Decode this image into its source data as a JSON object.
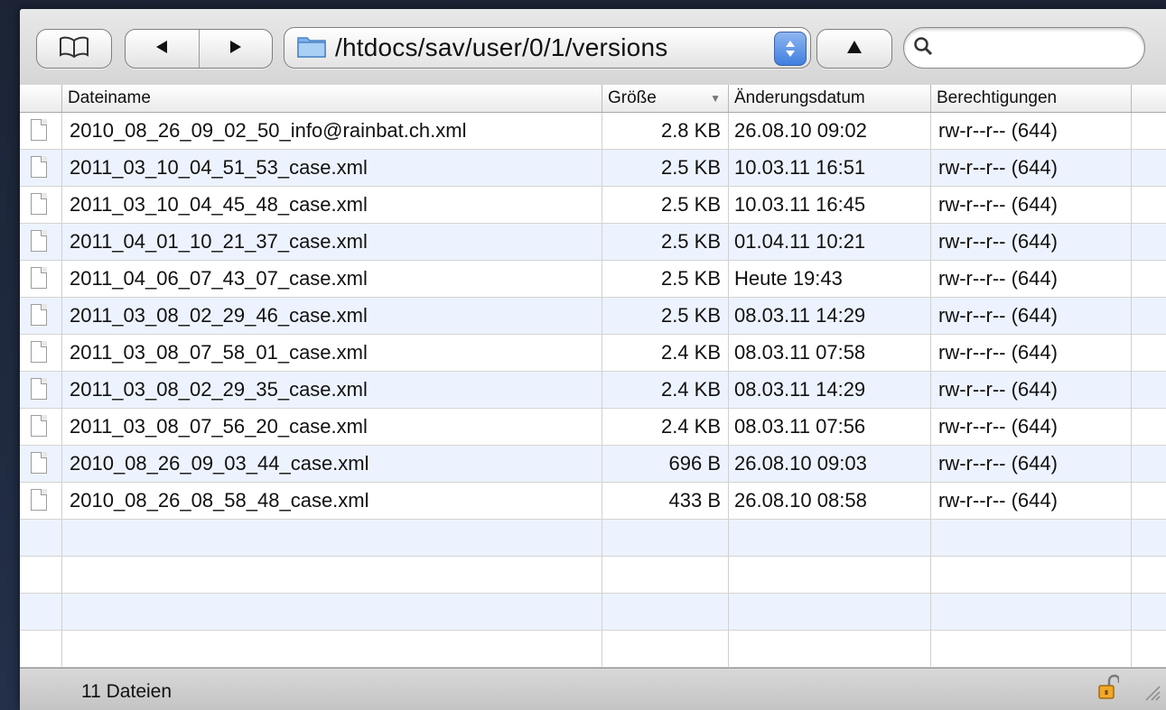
{
  "toolbar": {
    "path": "/htdocs/sav/user/0/1/versions",
    "search_placeholder": ""
  },
  "columns": {
    "name": "Dateiname",
    "size": "Größe",
    "date": "Änderungsdatum",
    "permissions": "Berechtigungen"
  },
  "sort": {
    "column": "size",
    "direction": "descending"
  },
  "files": [
    {
      "name": "2010_08_26_09_02_50_info@rainbat.ch.xml",
      "size": "2.8 KB",
      "date": "26.08.10 09:02",
      "perm": "rw-r--r-- (644)"
    },
    {
      "name": "2011_03_10_04_51_53_case.xml",
      "size": "2.5 KB",
      "date": "10.03.11 16:51",
      "perm": "rw-r--r-- (644)"
    },
    {
      "name": "2011_03_10_04_45_48_case.xml",
      "size": "2.5 KB",
      "date": "10.03.11 16:45",
      "perm": "rw-r--r-- (644)"
    },
    {
      "name": "2011_04_01_10_21_37_case.xml",
      "size": "2.5 KB",
      "date": "01.04.11 10:21",
      "perm": "rw-r--r-- (644)"
    },
    {
      "name": "2011_04_06_07_43_07_case.xml",
      "size": "2.5 KB",
      "date": "Heute 19:43",
      "perm": "rw-r--r-- (644)"
    },
    {
      "name": "2011_03_08_02_29_46_case.xml",
      "size": "2.5 KB",
      "date": "08.03.11 14:29",
      "perm": "rw-r--r-- (644)"
    },
    {
      "name": "2011_03_08_07_58_01_case.xml",
      "size": "2.4 KB",
      "date": "08.03.11 07:58",
      "perm": "rw-r--r-- (644)"
    },
    {
      "name": "2011_03_08_02_29_35_case.xml",
      "size": "2.4 KB",
      "date": "08.03.11 14:29",
      "perm": "rw-r--r-- (644)"
    },
    {
      "name": "2011_03_08_07_56_20_case.xml",
      "size": "2.4 KB",
      "date": "08.03.11 07:56",
      "perm": "rw-r--r-- (644)"
    },
    {
      "name": "2010_08_26_09_03_44_case.xml",
      "size": "696 B",
      "date": "26.08.10 09:03",
      "perm": "rw-r--r-- (644)"
    },
    {
      "name": "2010_08_26_08_58_48_case.xml",
      "size": "433 B",
      "date": "26.08.10 08:58",
      "perm": "rw-r--r-- (644)"
    }
  ],
  "status": {
    "count_text": "11 Dateien"
  },
  "icons": {
    "bookmarks": "book-icon",
    "back": "back-arrow-icon",
    "forward": "forward-arrow-icon",
    "folder": "folder-icon",
    "up": "up-arrow-icon",
    "search": "search-icon",
    "file": "document-icon",
    "lock": "unlocked-padlock-icon"
  },
  "colors": {
    "row_alt": "#edf3fe",
    "popup_accent": "#3f7fe0",
    "folder": "#6aa6e6",
    "lock": "#e8a020"
  }
}
